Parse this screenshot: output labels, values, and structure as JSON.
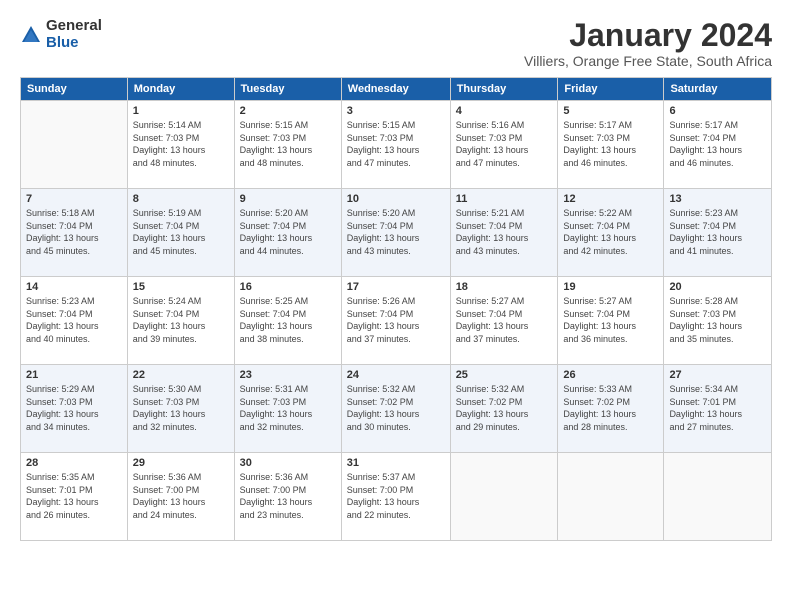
{
  "logo": {
    "general": "General",
    "blue": "Blue"
  },
  "title": {
    "month": "January 2024",
    "location": "Villiers, Orange Free State, South Africa"
  },
  "weekdays": [
    "Sunday",
    "Monday",
    "Tuesday",
    "Wednesday",
    "Thursday",
    "Friday",
    "Saturday"
  ],
  "weeks": [
    [
      {
        "day": "",
        "info": ""
      },
      {
        "day": "1",
        "info": "Sunrise: 5:14 AM\nSunset: 7:03 PM\nDaylight: 13 hours\nand 48 minutes."
      },
      {
        "day": "2",
        "info": "Sunrise: 5:15 AM\nSunset: 7:03 PM\nDaylight: 13 hours\nand 48 minutes."
      },
      {
        "day": "3",
        "info": "Sunrise: 5:15 AM\nSunset: 7:03 PM\nDaylight: 13 hours\nand 47 minutes."
      },
      {
        "day": "4",
        "info": "Sunrise: 5:16 AM\nSunset: 7:03 PM\nDaylight: 13 hours\nand 47 minutes."
      },
      {
        "day": "5",
        "info": "Sunrise: 5:17 AM\nSunset: 7:03 PM\nDaylight: 13 hours\nand 46 minutes."
      },
      {
        "day": "6",
        "info": "Sunrise: 5:17 AM\nSunset: 7:04 PM\nDaylight: 13 hours\nand 46 minutes."
      }
    ],
    [
      {
        "day": "7",
        "info": "Sunrise: 5:18 AM\nSunset: 7:04 PM\nDaylight: 13 hours\nand 45 minutes."
      },
      {
        "day": "8",
        "info": "Sunrise: 5:19 AM\nSunset: 7:04 PM\nDaylight: 13 hours\nand 45 minutes."
      },
      {
        "day": "9",
        "info": "Sunrise: 5:20 AM\nSunset: 7:04 PM\nDaylight: 13 hours\nand 44 minutes."
      },
      {
        "day": "10",
        "info": "Sunrise: 5:20 AM\nSunset: 7:04 PM\nDaylight: 13 hours\nand 43 minutes."
      },
      {
        "day": "11",
        "info": "Sunrise: 5:21 AM\nSunset: 7:04 PM\nDaylight: 13 hours\nand 43 minutes."
      },
      {
        "day": "12",
        "info": "Sunrise: 5:22 AM\nSunset: 7:04 PM\nDaylight: 13 hours\nand 42 minutes."
      },
      {
        "day": "13",
        "info": "Sunrise: 5:23 AM\nSunset: 7:04 PM\nDaylight: 13 hours\nand 41 minutes."
      }
    ],
    [
      {
        "day": "14",
        "info": "Sunrise: 5:23 AM\nSunset: 7:04 PM\nDaylight: 13 hours\nand 40 minutes."
      },
      {
        "day": "15",
        "info": "Sunrise: 5:24 AM\nSunset: 7:04 PM\nDaylight: 13 hours\nand 39 minutes."
      },
      {
        "day": "16",
        "info": "Sunrise: 5:25 AM\nSunset: 7:04 PM\nDaylight: 13 hours\nand 38 minutes."
      },
      {
        "day": "17",
        "info": "Sunrise: 5:26 AM\nSunset: 7:04 PM\nDaylight: 13 hours\nand 37 minutes."
      },
      {
        "day": "18",
        "info": "Sunrise: 5:27 AM\nSunset: 7:04 PM\nDaylight: 13 hours\nand 37 minutes."
      },
      {
        "day": "19",
        "info": "Sunrise: 5:27 AM\nSunset: 7:04 PM\nDaylight: 13 hours\nand 36 minutes."
      },
      {
        "day": "20",
        "info": "Sunrise: 5:28 AM\nSunset: 7:03 PM\nDaylight: 13 hours\nand 35 minutes."
      }
    ],
    [
      {
        "day": "21",
        "info": "Sunrise: 5:29 AM\nSunset: 7:03 PM\nDaylight: 13 hours\nand 34 minutes."
      },
      {
        "day": "22",
        "info": "Sunrise: 5:30 AM\nSunset: 7:03 PM\nDaylight: 13 hours\nand 32 minutes."
      },
      {
        "day": "23",
        "info": "Sunrise: 5:31 AM\nSunset: 7:03 PM\nDaylight: 13 hours\nand 32 minutes."
      },
      {
        "day": "24",
        "info": "Sunrise: 5:32 AM\nSunset: 7:02 PM\nDaylight: 13 hours\nand 30 minutes."
      },
      {
        "day": "25",
        "info": "Sunrise: 5:32 AM\nSunset: 7:02 PM\nDaylight: 13 hours\nand 29 minutes."
      },
      {
        "day": "26",
        "info": "Sunrise: 5:33 AM\nSunset: 7:02 PM\nDaylight: 13 hours\nand 28 minutes."
      },
      {
        "day": "27",
        "info": "Sunrise: 5:34 AM\nSunset: 7:01 PM\nDaylight: 13 hours\nand 27 minutes."
      }
    ],
    [
      {
        "day": "28",
        "info": "Sunrise: 5:35 AM\nSunset: 7:01 PM\nDaylight: 13 hours\nand 26 minutes."
      },
      {
        "day": "29",
        "info": "Sunrise: 5:36 AM\nSunset: 7:00 PM\nDaylight: 13 hours\nand 24 minutes."
      },
      {
        "day": "30",
        "info": "Sunrise: 5:36 AM\nSunset: 7:00 PM\nDaylight: 13 hours\nand 23 minutes."
      },
      {
        "day": "31",
        "info": "Sunrise: 5:37 AM\nSunset: 7:00 PM\nDaylight: 13 hours\nand 22 minutes."
      },
      {
        "day": "",
        "info": ""
      },
      {
        "day": "",
        "info": ""
      },
      {
        "day": "",
        "info": ""
      }
    ]
  ]
}
